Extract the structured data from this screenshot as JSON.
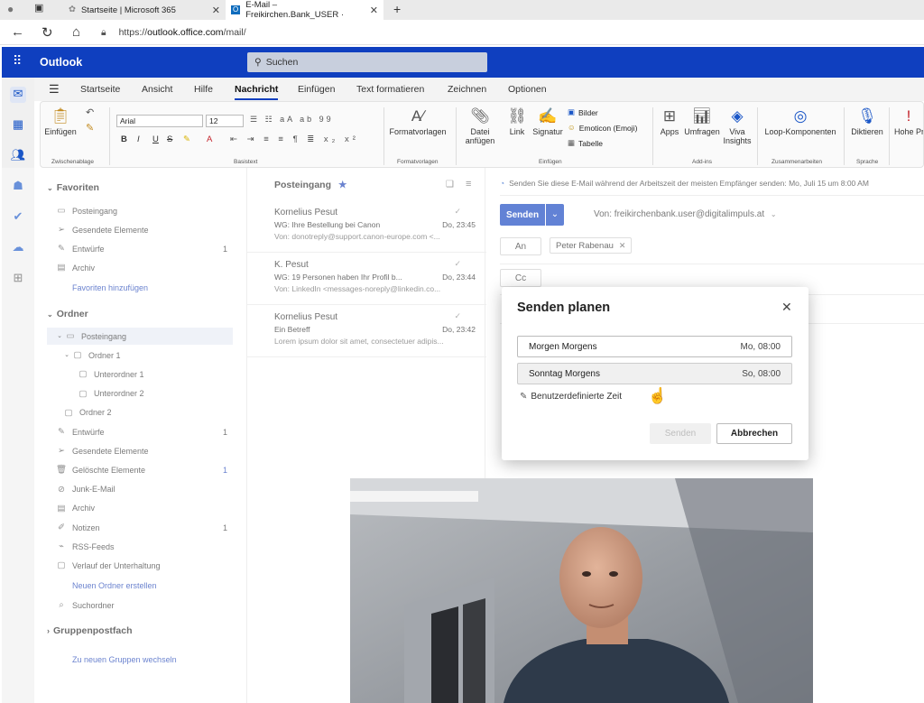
{
  "browser": {
    "tabs": [
      {
        "label": "Startseite | Microsoft 365",
        "active": false
      },
      {
        "label": "E-Mail – Freikirchen.Bank_USER ·",
        "active": true
      }
    ],
    "url_scheme": "https://",
    "url_host": "outlook.office.com",
    "url_path": "/mail/"
  },
  "outlook": {
    "brand": "Outlook",
    "search_placeholder": "Suchen",
    "accent": "#0f3fbf"
  },
  "menu_tabs": [
    "Startseite",
    "Ansicht",
    "Hilfe",
    "Nachricht",
    "Einfügen",
    "Text formatieren",
    "Zeichnen",
    "Optionen"
  ],
  "menu_active": "Nachricht",
  "ribbon": {
    "paste": "Einfügen",
    "group_clipboard": "Zwischenablage",
    "font_name": "Arial",
    "font_size": "12",
    "group_basic_text": "Basistext",
    "styles": "Formatvorlagen",
    "group_styles": "Formatvorlagen",
    "attach": "Datei anfügen",
    "link": "Link",
    "signature": "Signatur",
    "pictures": "Bilder",
    "emoji": "Emoticon (Emoji)",
    "table": "Tabelle",
    "group_insert": "Einfügen",
    "apps": "Apps",
    "polls": "Umfragen",
    "viva": "Viva Insights",
    "group_addins": "Add-ins",
    "loop": "Loop-Komponenten",
    "group_collab": "Zusammenarbeiten",
    "dictate": "Diktieren",
    "group_speech": "Sprache",
    "priority": "Hohe Priorität"
  },
  "folders": {
    "favorites_title": "Favoriten",
    "favorites": [
      {
        "label": "Posteingang",
        "icon": "inbox-icon",
        "count": ""
      },
      {
        "label": "Gesendete Elemente",
        "icon": "send-icon",
        "count": ""
      },
      {
        "label": "Entwürfe",
        "icon": "draft-icon",
        "count": "1"
      },
      {
        "label": "Archiv",
        "icon": "archive-icon",
        "count": ""
      }
    ],
    "add_favorite": "Favoriten hinzufügen",
    "folders_title": "Ordner",
    "items": [
      {
        "label": "Posteingang",
        "icon": "inbox-icon",
        "count": "",
        "selected": true
      },
      {
        "label": "Ordner 1",
        "icon": "folder-icon",
        "count": ""
      },
      {
        "label": "Unterordner 1",
        "icon": "folder-icon",
        "count": ""
      },
      {
        "label": "Unterordner 2",
        "icon": "folder-icon",
        "count": ""
      },
      {
        "label": "Ordner 2",
        "icon": "folder-icon",
        "count": ""
      },
      {
        "label": "Entwürfe",
        "icon": "draft-icon",
        "count": "1"
      },
      {
        "label": "Gesendete Elemente",
        "icon": "send-icon",
        "count": ""
      },
      {
        "label": "Gelöschte Elemente",
        "icon": "trash-icon",
        "count": "1"
      },
      {
        "label": "Junk-E-Mail",
        "icon": "junk-icon",
        "count": ""
      },
      {
        "label": "Archiv",
        "icon": "archive-icon",
        "count": ""
      },
      {
        "label": "Notizen",
        "icon": "note-icon",
        "count": "1"
      },
      {
        "label": "RSS-Feeds",
        "icon": "rss-icon",
        "count": ""
      },
      {
        "label": "Verlauf der Unterhaltung",
        "icon": "folder-icon",
        "count": ""
      }
    ],
    "new_folder": "Neuen Ordner erstellen",
    "search_folders": "Suchordner",
    "group_mailbox": "Gruppenpostfach",
    "switch_groups": "Zu neuen Gruppen wechseln"
  },
  "message_list": {
    "title": "Posteingang",
    "messages": [
      {
        "from": "Kornelius Pesut",
        "subject": "WG: Ihre Bestellung bei Canon",
        "time": "Do, 23:45",
        "preview": "Von: donotreply@support.canon-europe.com <..."
      },
      {
        "from": "K. Pesut",
        "subject": "WG: 19 Personen haben Ihr Profil b...",
        "time": "Do, 23:44",
        "preview": "Von: LinkedIn <messages-noreply@linkedin.co..."
      },
      {
        "from": "Kornelius Pesut",
        "subject": "Ein Betreff",
        "time": "Do, 23:42",
        "preview": "Lorem ipsum dolor sit amet, consectetuer adipis..."
      }
    ]
  },
  "compose": {
    "hint": "Senden Sie diese E-Mail während der Arbeitszeit der meisten Empfänger senden: Mo, Juli 15 um 8:00 AM",
    "send": "Senden",
    "from": "Von: freikirchenbank.user@digitalimpuls.at",
    "to_label": "An",
    "recipient": "Peter Rabenau",
    "cc_label": "Cc"
  },
  "dialog": {
    "title": "Senden planen",
    "options": [
      {
        "label": "Morgen Morgens",
        "time": "Mo, 08:00"
      },
      {
        "label": "Sonntag Morgens",
        "time": "So, 08:00"
      }
    ],
    "custom_time": "Benutzerdefinierte Zeit",
    "send": "Senden",
    "cancel": "Abbrechen"
  }
}
